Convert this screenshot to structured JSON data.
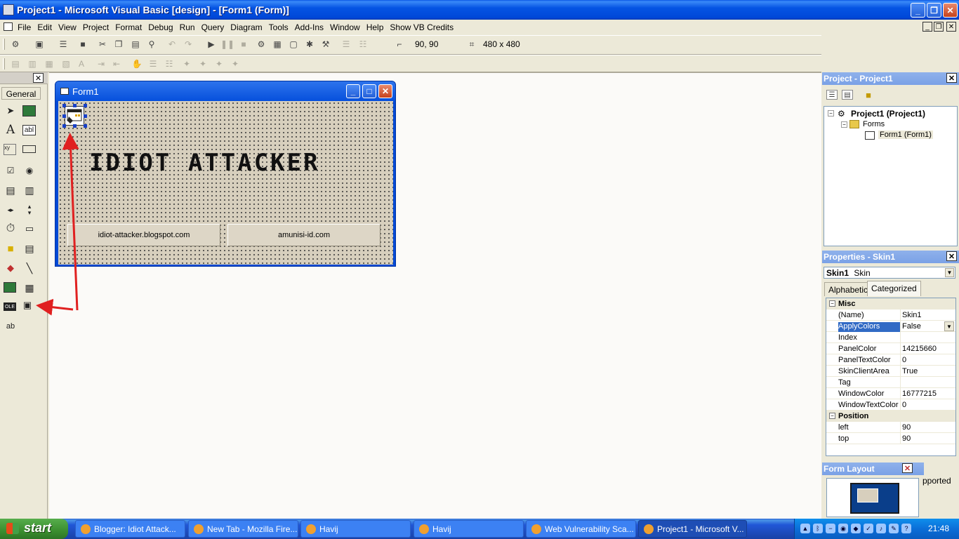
{
  "window": {
    "title": "Project1 - Microsoft Visual Basic [design] - [Form1 (Form)]",
    "minimize": "_",
    "maximize": "❐",
    "close": "✕"
  },
  "menu": {
    "items": [
      "File",
      "Edit",
      "View",
      "Project",
      "Format",
      "Debug",
      "Run",
      "Query",
      "Diagram",
      "Tools",
      "Add-Ins",
      "Window",
      "Help",
      "Show VB Credits"
    ],
    "mdi_min": "_",
    "mdi_restore": "❐",
    "mdi_close": "✕"
  },
  "toolbar": {
    "position_readout": "90, 90",
    "size_readout": "480 x 480"
  },
  "toolbox": {
    "close": "✕",
    "tab_label": "General",
    "tools": [
      "pointer",
      "picturebox",
      "label",
      "textbox",
      "frame",
      "commandbutton",
      "checkbox",
      "optionbutton",
      "combobox",
      "listbox",
      "hscrollbar",
      "vscrollbar",
      "timer",
      "drivelistbox",
      "dirlistbox",
      "filelistbox",
      "shape",
      "line",
      "image",
      "data",
      "ole",
      "skin",
      "ab"
    ]
  },
  "form1": {
    "title": "Form1",
    "banner": "IDIOT ATTACKER",
    "button1": "idiot-attacker.blogspot.com",
    "button2": "amunisi-id.com",
    "min": "_",
    "max": "□",
    "close": "✕"
  },
  "project_panel": {
    "title": "Project - Project1",
    "close": "✕",
    "tree": {
      "root": "Project1 (Project1)",
      "folder": "Forms",
      "item": "Form1 (Form1)"
    }
  },
  "properties_panel": {
    "title": "Properties - Skin1",
    "close": "✕",
    "object_name": "Skin1",
    "object_type": "Skin",
    "tabs": [
      "Alphabetic",
      "Categorized"
    ],
    "active_tab": "Categorized",
    "categories": [
      {
        "name": "Misc",
        "rows": [
          {
            "name": "(Name)",
            "value": "Skin1"
          },
          {
            "name": "ApplyColors",
            "value": "False",
            "selected": true
          },
          {
            "name": "Index",
            "value": ""
          },
          {
            "name": "PanelColor",
            "value": "14215660"
          },
          {
            "name": "PanelTextColor",
            "value": "0"
          },
          {
            "name": "SkinClientArea",
            "value": "True"
          },
          {
            "name": "Tag",
            "value": ""
          },
          {
            "name": "WindowColor",
            "value": "16777215"
          },
          {
            "name": "WindowTextColor",
            "value": "0"
          }
        ]
      },
      {
        "name": "Position",
        "rows": [
          {
            "name": "left",
            "value": "90"
          },
          {
            "name": "top",
            "value": "90"
          }
        ]
      }
    ]
  },
  "layout_panel": {
    "title": "Form Layout",
    "close": "✕",
    "partial_text": "pported"
  },
  "taskbar": {
    "start": "start",
    "tasks": [
      {
        "label": "Blogger: Idiot Attack..."
      },
      {
        "label": "New Tab - Mozilla Fire..."
      },
      {
        "label": "Havij"
      },
      {
        "label": "Havij"
      },
      {
        "label": "Web Vulnerability Sca..."
      },
      {
        "label": "Project1 - Microsoft V...",
        "active": true
      }
    ],
    "clock": "21:48"
  },
  "colors": {
    "titlebar": "#0054e3",
    "annotation_arrow": "#e02020",
    "selection": "#316ac5"
  }
}
